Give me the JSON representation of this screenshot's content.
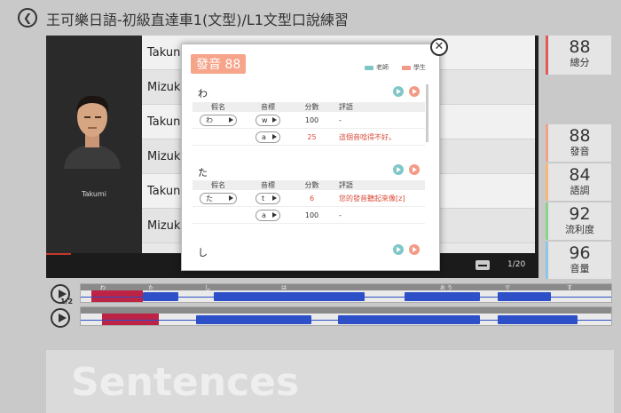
{
  "header": {
    "back_icon": "back-arrow-icon",
    "title": "王可樂日語-初級直達車1(文型)/L1文型口說練習"
  },
  "video": {
    "speaker": "Takumi",
    "lines": [
      "Takun",
      "Mizuk",
      "Takun",
      "Mizuk",
      "Takun",
      "Mizuk"
    ],
    "page": "1/20"
  },
  "scores": {
    "total": {
      "value": "88",
      "label": "總分",
      "color": "#e05a5a"
    },
    "items": [
      {
        "value": "88",
        "label": "發音",
        "color": "#f2a287"
      },
      {
        "value": "84",
        "label": "語調",
        "color": "#f5b87a"
      },
      {
        "value": "92",
        "label": "流利度",
        "color": "#8cd28a"
      },
      {
        "value": "96",
        "label": "音量",
        "color": "#8fc5e6"
      }
    ]
  },
  "waveform": {
    "rate": "1/2",
    "top_labels": [
      "わ",
      "た",
      "し",
      "は",
      "お う",
      "で",
      "す"
    ]
  },
  "sentences_label": "Sentences",
  "popup": {
    "badge": "發音 88",
    "legend": {
      "teacher": "老師",
      "student": "學生",
      "teacher_color": "#7fc7c7",
      "student_color": "#f29a86"
    },
    "headers": {
      "kana": "假名",
      "phonetic": "音標",
      "score": "分數",
      "comment": "評語"
    },
    "sections": [
      {
        "kana": "わ",
        "rows": [
          {
            "kana": "わ",
            "phonetic": "w",
            "score": "100",
            "comment": "-",
            "bad": false
          },
          {
            "kana": "",
            "phonetic": "a",
            "score": "25",
            "comment": "這個音唸得不好。",
            "bad": true
          }
        ]
      },
      {
        "kana": "た",
        "rows": [
          {
            "kana": "た",
            "phonetic": "t",
            "score": "6",
            "comment": "您的發音聽起來像[z]",
            "bad": true
          },
          {
            "kana": "",
            "phonetic": "a",
            "score": "100",
            "comment": "-",
            "bad": false
          }
        ]
      },
      {
        "kana": "し",
        "rows": []
      }
    ],
    "close_icon": "close-icon",
    "teacher_play_icon": "play-teacher-icon",
    "student_play_icon": "play-student-icon"
  }
}
